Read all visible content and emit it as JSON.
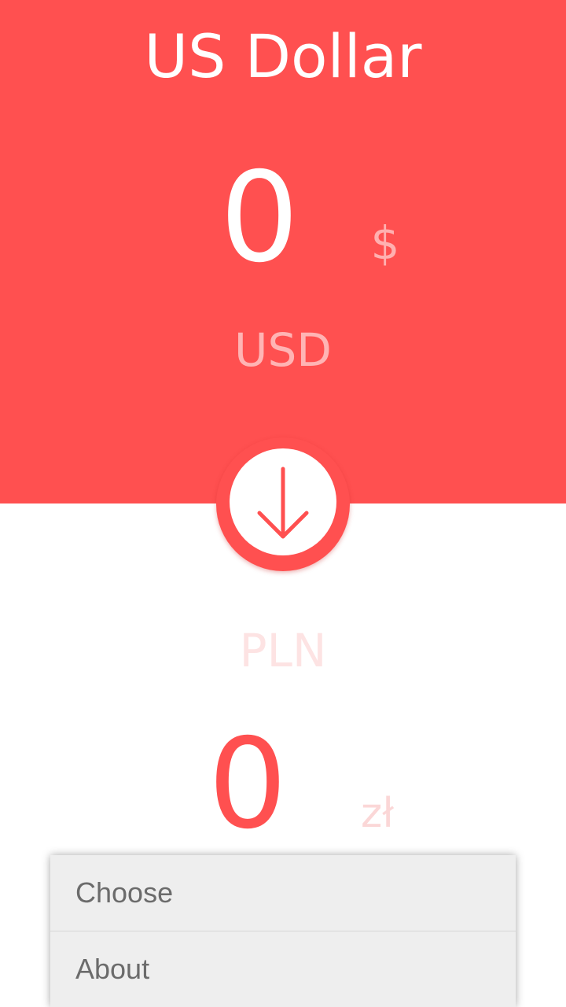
{
  "app": {
    "title": "US Dollar"
  },
  "from": {
    "amount": "0",
    "symbol": "$",
    "code": "USD"
  },
  "to": {
    "code": "PLN",
    "amount": "0",
    "symbol": "zł"
  },
  "swap": {
    "icon": "arrow-down-icon"
  },
  "menu": {
    "items": [
      {
        "label": "Choose"
      },
      {
        "label": "About"
      }
    ]
  },
  "colors": {
    "accent": "#ff5050",
    "background": "#ffffff",
    "menu_background": "#eeeeee",
    "menu_text": "#6b6b6b"
  }
}
